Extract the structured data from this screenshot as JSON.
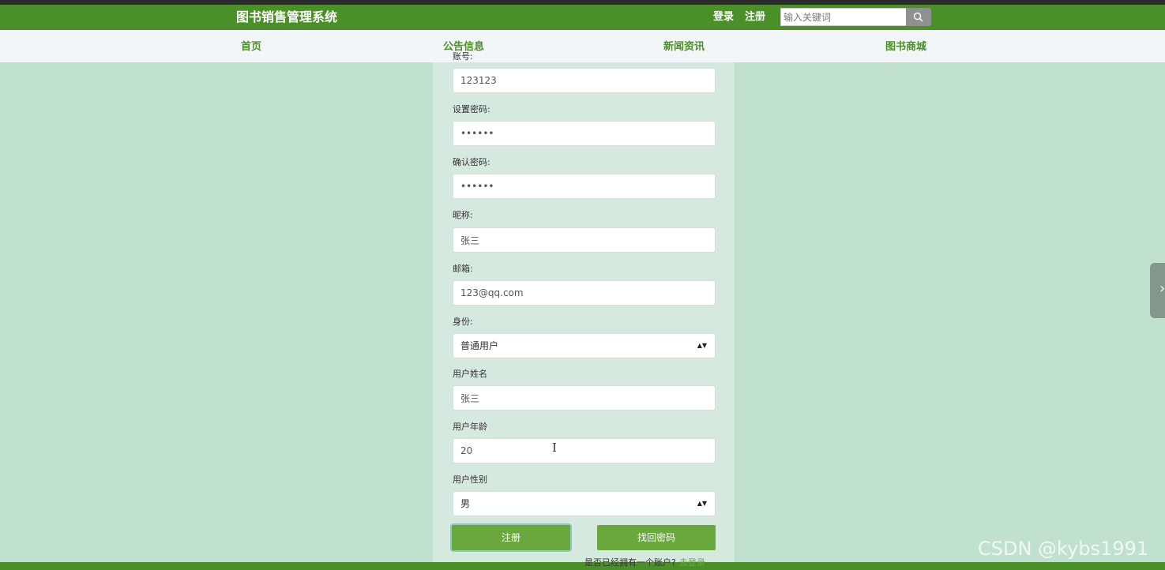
{
  "header": {
    "brand": "图书销售管理系统",
    "login": "登录",
    "register": "注册",
    "search_placeholder": "输入关键词",
    "search_icon": "magnifier-icon"
  },
  "nav": {
    "items": [
      {
        "label": "首页"
      },
      {
        "label": "公告信息"
      },
      {
        "label": "新闻资讯"
      },
      {
        "label": "图书商城"
      }
    ]
  },
  "form": {
    "fields": [
      {
        "label": "账号:",
        "value": "123123"
      },
      {
        "label": "设置密码:",
        "value": "••••••"
      },
      {
        "label": "确认密码:",
        "value": "••••••"
      },
      {
        "label": "昵称:",
        "value": "张三"
      },
      {
        "label": "邮箱:",
        "value": "123@qq.com"
      },
      {
        "label": "身份:",
        "value": "普通用户"
      },
      {
        "label": "用户姓名",
        "value": "张三"
      },
      {
        "label": "用户年龄",
        "value": "20"
      },
      {
        "label": "用户性别",
        "value": "男"
      }
    ],
    "select_arrows": "▲▼",
    "buttons": {
      "register": "注册",
      "recover": "找回密码"
    },
    "footer": {
      "question": "是否已经拥有一个账户?",
      "link": "去登录"
    }
  },
  "side_toggle": {
    "glyph": "›",
    "icon": "chevron-right-icon"
  },
  "watermark": "CSDN @kybs1991",
  "colors": {
    "header_green": "#4b8f29",
    "button_green": "#6aa83e",
    "background": "#c1e1cf",
    "panel": "#d6e9de"
  }
}
